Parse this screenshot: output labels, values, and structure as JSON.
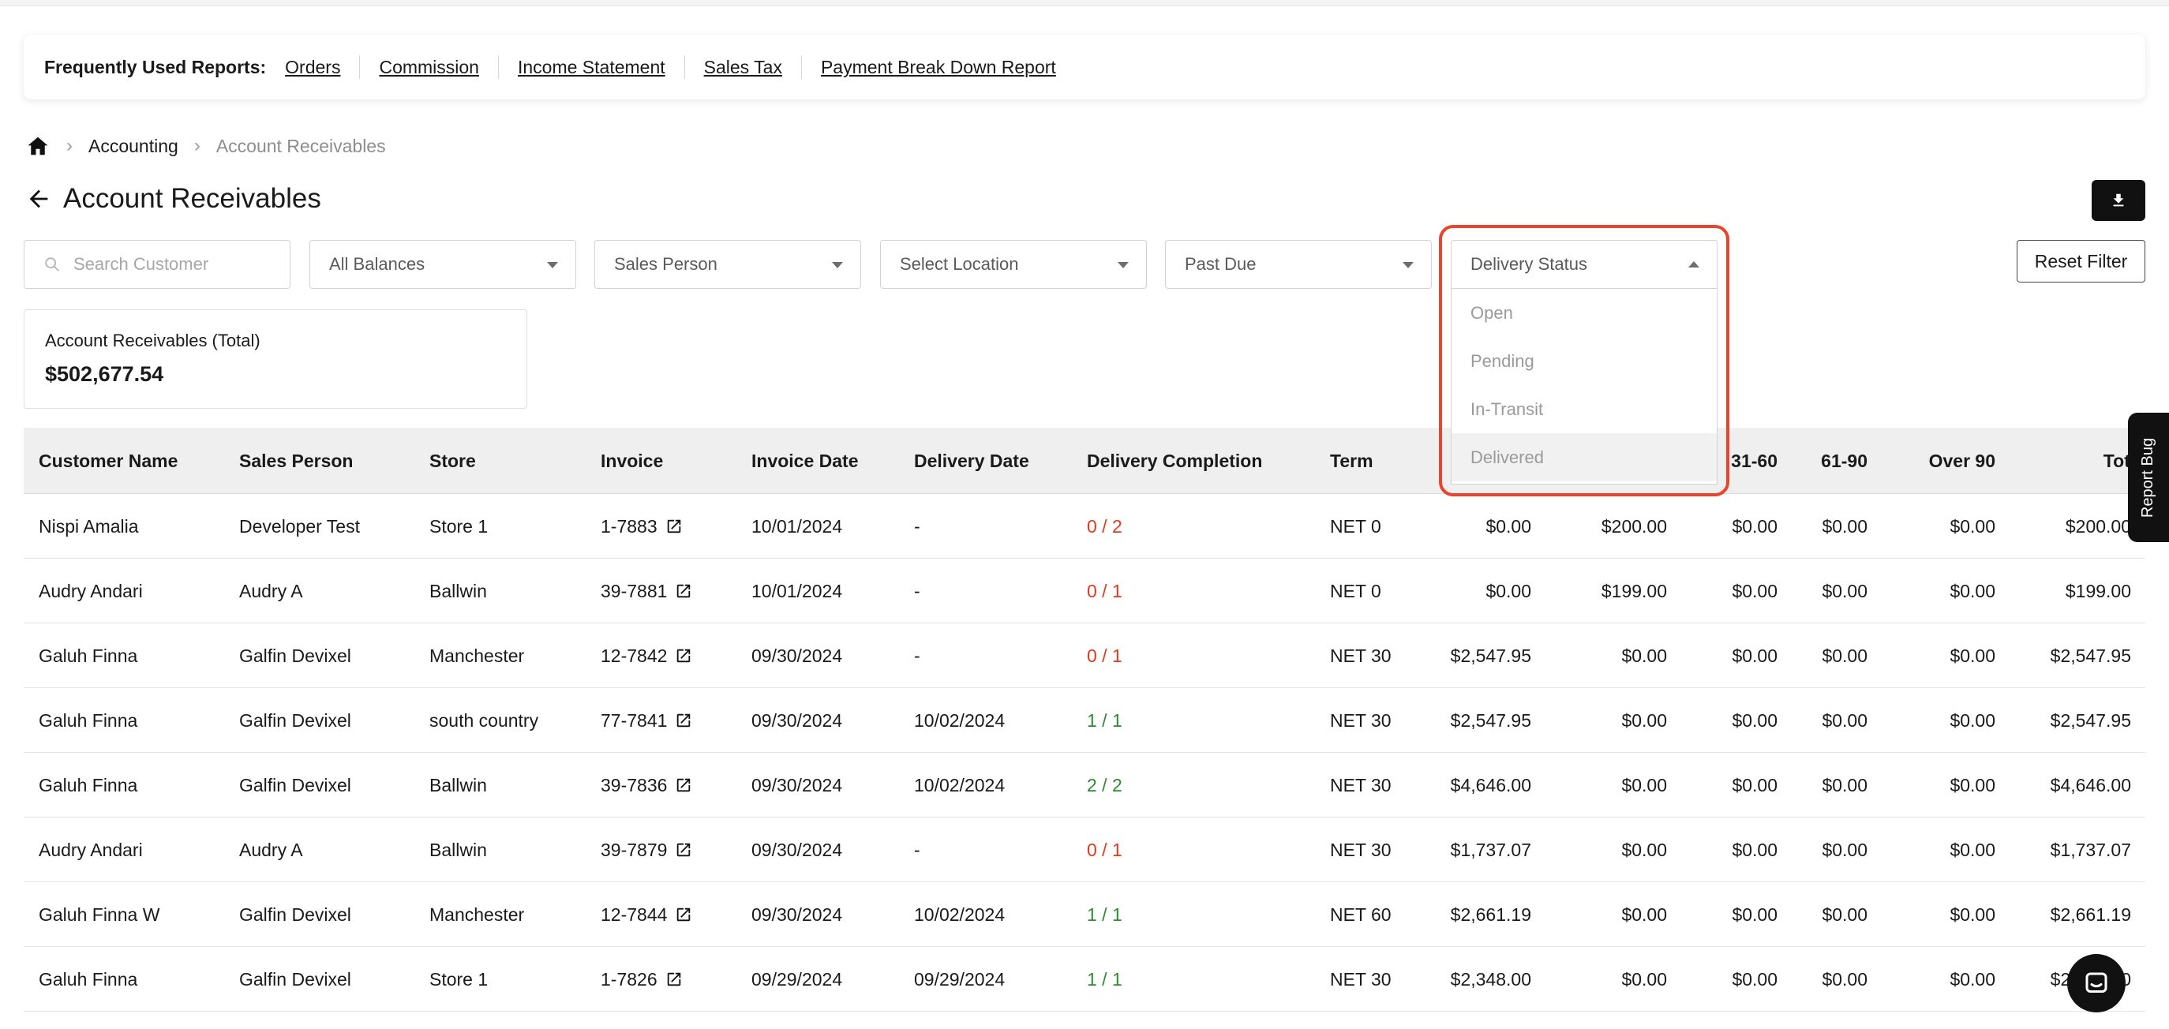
{
  "frequent_reports": {
    "title": "Frequently Used Reports:",
    "links": [
      "Orders",
      "Commission",
      "Income Statement",
      "Sales Tax",
      "Payment Break Down Report"
    ]
  },
  "breadcrumb": {
    "parent": "Accounting",
    "current": "Account Receivables"
  },
  "page_title": "Account Receivables",
  "filters": {
    "search_placeholder": "Search Customer",
    "balances": "All Balances",
    "sales_person": "Sales Person",
    "location": "Select Location",
    "past_due": "Past Due",
    "delivery_status": "Delivery Status",
    "reset_label": "Reset Filter"
  },
  "delivery_status_options": [
    "Open",
    "Pending",
    "In-Transit",
    "Delivered"
  ],
  "total_card": {
    "label": "Account Receivables (Total)",
    "value": "$502,677.54"
  },
  "table": {
    "headers": [
      "Customer Name",
      "Sales Person",
      "Store",
      "Invoice",
      "Invoice Date",
      "Delivery Date",
      "Delivery Completion",
      "Term",
      "",
      "",
      "31-60",
      "61-90",
      "Over 90",
      "Total"
    ],
    "rows": [
      [
        "Nispi Amalia",
        "Developer Test",
        "Store 1",
        "1-7883",
        "10/01/2024",
        "-",
        "0 / 2",
        "NET 0",
        "$0.00",
        "$200.00",
        "$0.00",
        "$0.00",
        "$0.00",
        "$200.00"
      ],
      [
        "Audry Andari",
        "Audry A",
        "Ballwin",
        "39-7881",
        "10/01/2024",
        "-",
        "0 / 1",
        "NET 0",
        "$0.00",
        "$199.00",
        "$0.00",
        "$0.00",
        "$0.00",
        "$199.00"
      ],
      [
        "Galuh Finna",
        "Galfin Devixel",
        "Manchester",
        "12-7842",
        "09/30/2024",
        "-",
        "0 / 1",
        "NET 30",
        "$2,547.95",
        "$0.00",
        "$0.00",
        "$0.00",
        "$0.00",
        "$2,547.95"
      ],
      [
        "Galuh Finna",
        "Galfin Devixel",
        "south country",
        "77-7841",
        "09/30/2024",
        "10/02/2024",
        "1 / 1",
        "NET 30",
        "$2,547.95",
        "$0.00",
        "$0.00",
        "$0.00",
        "$0.00",
        "$2,547.95"
      ],
      [
        "Galuh Finna",
        "Galfin Devixel",
        "Ballwin",
        "39-7836",
        "09/30/2024",
        "10/02/2024",
        "2 / 2",
        "NET 30",
        "$4,646.00",
        "$0.00",
        "$0.00",
        "$0.00",
        "$0.00",
        "$4,646.00"
      ],
      [
        "Audry Andari",
        "Audry A",
        "Ballwin",
        "39-7879",
        "09/30/2024",
        "-",
        "0 / 1",
        "NET 30",
        "$1,737.07",
        "$0.00",
        "$0.00",
        "$0.00",
        "$0.00",
        "$1,737.07"
      ],
      [
        "Galuh Finna W",
        "Galfin Devixel",
        "Manchester",
        "12-7844",
        "09/30/2024",
        "10/02/2024",
        "1 / 1",
        "NET 60",
        "$2,661.19",
        "$0.00",
        "$0.00",
        "$0.00",
        "$0.00",
        "$2,661.19"
      ],
      [
        "Galuh Finna",
        "Galfin Devixel",
        "Store 1",
        "1-7826",
        "09/29/2024",
        "09/29/2024",
        "1 / 1",
        "NET 30",
        "$2,348.00",
        "$0.00",
        "$0.00",
        "$0.00",
        "$0.00",
        "$2,348.00"
      ]
    ]
  },
  "report_bug_label": "Report Bug",
  "colors": {
    "completion_incomplete": "#e03a1e",
    "completion_complete": "#2e8b2e",
    "highlight": "#e8452c"
  }
}
